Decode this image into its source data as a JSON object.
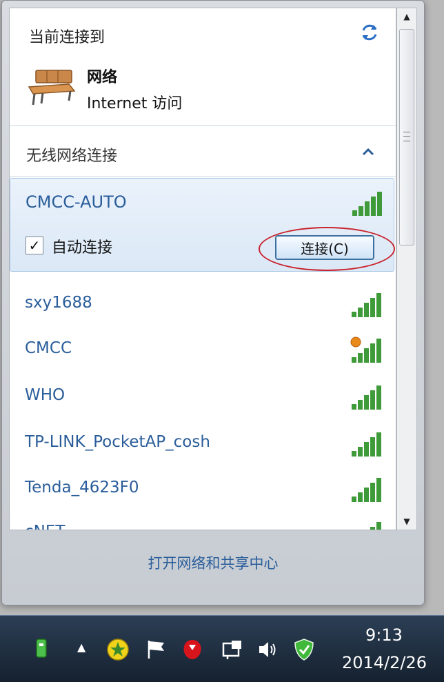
{
  "current": {
    "title": "当前连接到",
    "network_name": "网络",
    "access": "Internet 访问"
  },
  "wireless": {
    "title": "无线网络连接",
    "selected": {
      "ssid": "CMCC-AUTO",
      "auto_connect_label": "自动连接",
      "auto_connect_checked": "✓",
      "connect_label": "连接(C)"
    },
    "networks": [
      {
        "ssid": "sxy1688"
      },
      {
        "ssid": "CMCC"
      },
      {
        "ssid": "WHO"
      },
      {
        "ssid": "TP-LINK_PocketAP_cosh"
      },
      {
        "ssid": "Tenda_4623F0"
      },
      {
        "ssid": "cNET"
      }
    ]
  },
  "footer": {
    "open_center": "打开网络和共享中心"
  },
  "taskbar": {
    "time": "9:13",
    "date": "2014/2/26"
  },
  "colors": {
    "accent": "#2a5d9a",
    "highlight": "#c8232c",
    "signal": "#3f9a3a"
  }
}
